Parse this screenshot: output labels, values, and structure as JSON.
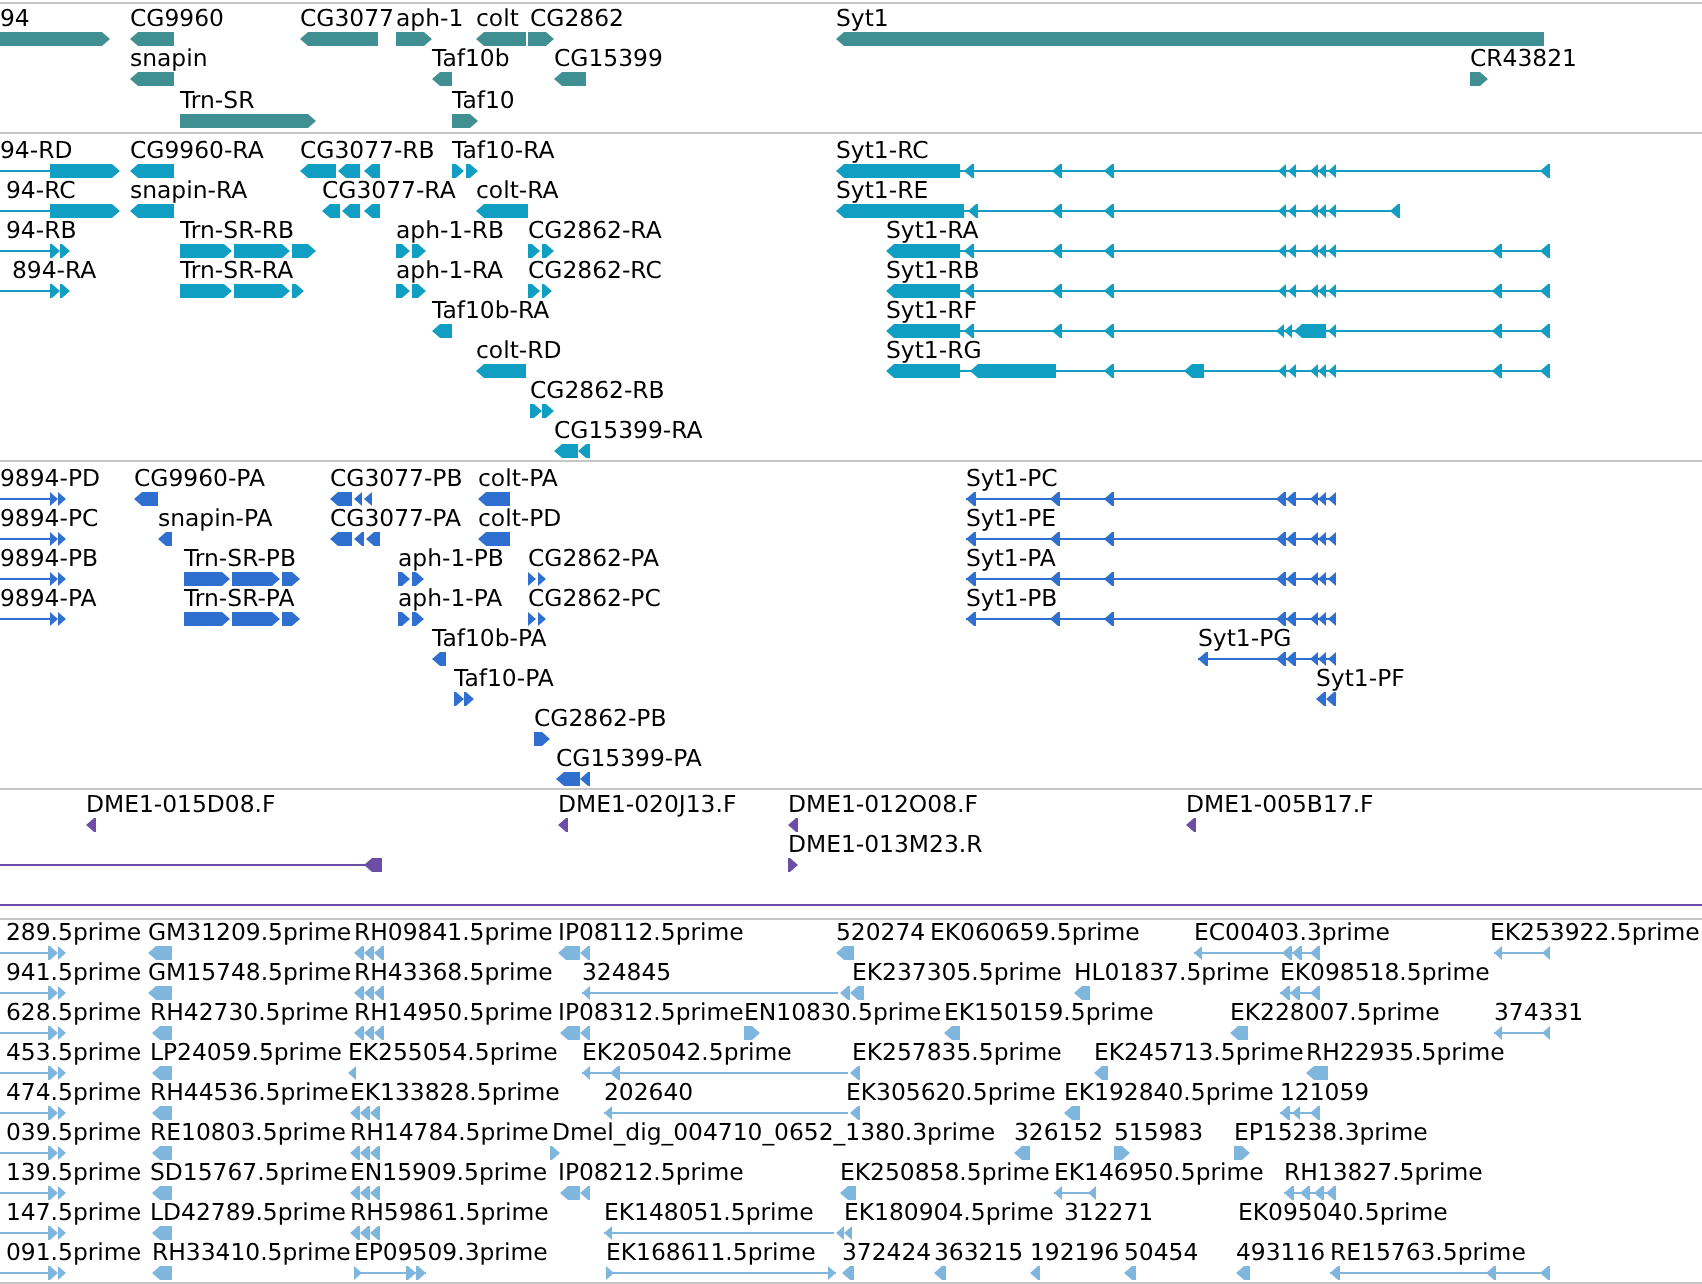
{
  "tracks": [
    {
      "kind": "gene",
      "color": "#3f8f93",
      "rows": [
        {
          "features": [
            {
              "label": "94",
              "reverse": false
            },
            {
              "label": "CG9960",
              "reverse": true
            },
            {
              "label": "CG3077",
              "reverse": true
            },
            {
              "label": "aph-1",
              "reverse": false
            },
            {
              "label": "colt",
              "reverse": true
            },
            {
              "label": "CG2862",
              "reverse": false
            },
            {
              "label": "Syt1",
              "reverse": true
            }
          ]
        },
        {
          "features": [
            {
              "label": "snapin",
              "reverse": true
            },
            {
              "label": "Taf10b",
              "reverse": true
            },
            {
              "label": "CG15399",
              "reverse": true
            },
            {
              "label": "CR43821",
              "reverse": false
            }
          ]
        },
        {
          "features": [
            {
              "label": "Trn-SR",
              "reverse": false
            },
            {
              "label": "Taf10",
              "reverse": false
            }
          ]
        }
      ]
    },
    {
      "kind": "transcript",
      "color": "#109ec2",
      "rows": [
        {
          "features": [
            {
              "label": "94-RD",
              "reverse": false
            },
            {
              "label": "CG9960-RA",
              "reverse": true
            },
            {
              "label": "CG3077-RB",
              "reverse": true
            },
            {
              "label": "Taf10-RA",
              "reverse": false
            },
            {
              "label": "Syt1-RC",
              "reverse": true
            }
          ]
        },
        {
          "features": [
            {
              "label": "94-RC",
              "reverse": false
            },
            {
              "label": "snapin-RA",
              "reverse": true
            },
            {
              "label": "CG3077-RA",
              "reverse": true
            },
            {
              "label": "colt-RA",
              "reverse": true
            },
            {
              "label": "Syt1-RE",
              "reverse": true
            }
          ]
        },
        {
          "features": [
            {
              "label": "94-RB",
              "reverse": false
            },
            {
              "label": "Trn-SR-RB",
              "reverse": false
            },
            {
              "label": "aph-1-RB",
              "reverse": false
            },
            {
              "label": "CG2862-RA",
              "reverse": false
            },
            {
              "label": "Syt1-RA",
              "reverse": true
            }
          ]
        },
        {
          "features": [
            {
              "label": "894-RA",
              "reverse": false
            },
            {
              "label": "Trn-SR-RA",
              "reverse": false
            },
            {
              "label": "aph-1-RA",
              "reverse": false
            },
            {
              "label": "CG2862-RC",
              "reverse": false
            },
            {
              "label": "Syt1-RB",
              "reverse": true
            }
          ]
        },
        {
          "features": [
            {
              "label": "Taf10b-RA",
              "reverse": true
            },
            {
              "label": "Syt1-RF",
              "reverse": true
            }
          ]
        },
        {
          "features": [
            {
              "label": "colt-RD",
              "reverse": true
            },
            {
              "label": "Syt1-RG",
              "reverse": true
            }
          ]
        },
        {
          "features": [
            {
              "label": "CG2862-RB",
              "reverse": false
            }
          ]
        },
        {
          "features": [
            {
              "label": "CG15399-RA",
              "reverse": true
            }
          ]
        }
      ]
    },
    {
      "kind": "protein",
      "color": "#2f6fd0",
      "rows": [
        {
          "features": [
            {
              "label": "9894-PD",
              "reverse": false
            },
            {
              "label": "CG9960-PA",
              "reverse": true
            },
            {
              "label": "CG3077-PB",
              "reverse": true
            },
            {
              "label": "colt-PA",
              "reverse": true
            },
            {
              "label": "Syt1-PC",
              "reverse": true
            }
          ]
        },
        {
          "features": [
            {
              "label": "9894-PC",
              "reverse": false
            },
            {
              "label": "snapin-PA",
              "reverse": true
            },
            {
              "label": "CG3077-PA",
              "reverse": true
            },
            {
              "label": "colt-PD",
              "reverse": true
            },
            {
              "label": "Syt1-PE",
              "reverse": true
            }
          ]
        },
        {
          "features": [
            {
              "label": "9894-PB",
              "reverse": false
            },
            {
              "label": "Trn-SR-PB",
              "reverse": false
            },
            {
              "label": "aph-1-PB",
              "reverse": false
            },
            {
              "label": "CG2862-PA",
              "reverse": false
            },
            {
              "label": "Syt1-PA",
              "reverse": true
            }
          ]
        },
        {
          "features": [
            {
              "label": "9894-PA",
              "reverse": false
            },
            {
              "label": "Trn-SR-PA",
              "reverse": false
            },
            {
              "label": "aph-1-PA",
              "reverse": false
            },
            {
              "label": "CG2862-PC",
              "reverse": false
            },
            {
              "label": "Syt1-PB",
              "reverse": true
            }
          ]
        },
        {
          "features": [
            {
              "label": "Taf10b-PA",
              "reverse": true
            },
            {
              "label": "Syt1-PG",
              "reverse": true
            }
          ]
        },
        {
          "features": [
            {
              "label": "Taf10-PA",
              "reverse": false
            },
            {
              "label": "Syt1-PF",
              "reverse": true
            }
          ]
        },
        {
          "features": [
            {
              "label": "CG2862-PB",
              "reverse": false
            }
          ]
        },
        {
          "features": [
            {
              "label": "CG15399-PA",
              "reverse": true
            }
          ]
        }
      ]
    },
    {
      "kind": "clone",
      "color": "#6d4ea6",
      "rows": [
        {
          "features": [
            {
              "label": "DME1-015D08.F",
              "reverse": true
            },
            {
              "label": "DME1-020J13.F",
              "reverse": true
            },
            {
              "label": "DME1-012O08.F",
              "reverse": true
            },
            {
              "label": "DME1-005B17.F",
              "reverse": true
            }
          ]
        },
        {
          "features": [
            {
              "reverse": true
            },
            {
              "label": "DME1-013M23.R",
              "reverse": false
            }
          ]
        }
      ]
    },
    {
      "kind": "est",
      "color": "#7fb6de",
      "rows": [
        {
          "features": [
            {
              "label": "289.5prime",
              "reverse": false
            },
            {
              "label": "GM31209.5prime",
              "reverse": true
            },
            {
              "label": "RH09841.5prime",
              "reverse": true
            },
            {
              "label": "IP08112.5prime",
              "reverse": true
            },
            {
              "label": "520274",
              "reverse": true
            },
            {
              "label": "EK060659.5prime"
            },
            {
              "label": "EC00403.3prime",
              "reverse": true
            },
            {
              "label": "EK253922.5prime",
              "reverse": true
            }
          ]
        },
        {
          "features": [
            {
              "label": "941.5prime",
              "reverse": false
            },
            {
              "label": "GM15748.5prime",
              "reverse": true
            },
            {
              "label": "RH43368.5prime",
              "reverse": true
            },
            {
              "label": "324845",
              "reverse": true
            },
            {
              "label": "EK237305.5prime",
              "reverse": true
            },
            {
              "label": "HL01837.5prime",
              "reverse": true
            },
            {
              "label": "EK098518.5prime",
              "reverse": true
            }
          ]
        },
        {
          "features": [
            {
              "label": "628.5prime",
              "reverse": false
            },
            {
              "label": "RH42730.5prime",
              "reverse": true
            },
            {
              "label": "RH14950.5prime",
              "reverse": true
            },
            {
              "label": "IP08312.5prime",
              "reverse": true
            },
            {
              "label": "EN10830.5prime",
              "reverse": false
            },
            {
              "label": "EK150159.5prime",
              "reverse": true
            },
            {
              "label": "EK228007.5prime",
              "reverse": true
            },
            {
              "label": "374331",
              "reverse": true
            }
          ]
        },
        {
          "features": [
            {
              "label": "453.5prime",
              "reverse": false
            },
            {
              "label": "LP24059.5prime",
              "reverse": true
            },
            {
              "label": "EK255054.5prime",
              "reverse": true
            },
            {
              "label": "EK205042.5prime",
              "reverse": true
            },
            {
              "label": "EK257835.5prime",
              "reverse": true
            },
            {
              "label": "EK245713.5prime",
              "reverse": true
            },
            {
              "label": "RH22935.5prime",
              "reverse": true
            }
          ]
        },
        {
          "features": [
            {
              "label": "474.5prime",
              "reverse": false
            },
            {
              "label": "RH44536.5prime",
              "reverse": true
            },
            {
              "label": "EK133828.5prime",
              "reverse": true
            },
            {
              "label": "202640",
              "reverse": true
            },
            {
              "label": "EK305620.5prime",
              "reverse": true
            },
            {
              "label": "EK192840.5prime",
              "reverse": true
            },
            {
              "label": "121059",
              "reverse": true
            }
          ]
        },
        {
          "features": [
            {
              "label": "039.5prime",
              "reverse": false
            },
            {
              "label": "RE10803.5prime",
              "reverse": true
            },
            {
              "label": "RH14784.5prime",
              "reverse": true
            },
            {
              "label": "Dmel_dig_004710_0652_1380.3prime",
              "reverse": false
            },
            {
              "label": "326152",
              "reverse": true
            },
            {
              "label": "515983",
              "reverse": false
            },
            {
              "label": "EP15238.3prime",
              "reverse": false
            }
          ]
        },
        {
          "features": [
            {
              "label": "139.5prime",
              "reverse": false
            },
            {
              "label": "SD15767.5prime",
              "reverse": true
            },
            {
              "label": "EN15909.5prime",
              "reverse": true
            },
            {
              "label": "IP08212.5prime",
              "reverse": true
            },
            {
              "label": "EK250858.5prime",
              "reverse": true
            },
            {
              "label": "EK146950.5prime",
              "reverse": true
            },
            {
              "label": "RH13827.5prime",
              "reverse": true
            }
          ]
        },
        {
          "features": [
            {
              "label": "147.5prime",
              "reverse": false
            },
            {
              "label": "LD42789.5prime",
              "reverse": true
            },
            {
              "label": "RH59861.5prime",
              "reverse": true
            },
            {
              "label": "EK148051.5prime",
              "reverse": true
            },
            {
              "label": "EK180904.5prime",
              "reverse": true
            },
            {
              "label": "312271"
            },
            {
              "label": "EK095040.5prime"
            }
          ]
        },
        {
          "features": [
            {
              "label": "091.5prime",
              "reverse": false
            },
            {
              "label": "RH33410.5prime",
              "reverse": true
            },
            {
              "label": "EP09509.3prime",
              "reverse": false
            },
            {
              "label": "EK168611.5prime",
              "reverse": false
            },
            {
              "label": "372424",
              "reverse": true
            },
            {
              "label": "363215",
              "reverse": true
            },
            {
              "label": "192196",
              "reverse": true
            },
            {
              "label": "50454",
              "reverse": true
            },
            {
              "label": "493116",
              "reverse": true
            },
            {
              "label": "RE15763.5prime",
              "reverse": true
            }
          ]
        }
      ]
    }
  ]
}
